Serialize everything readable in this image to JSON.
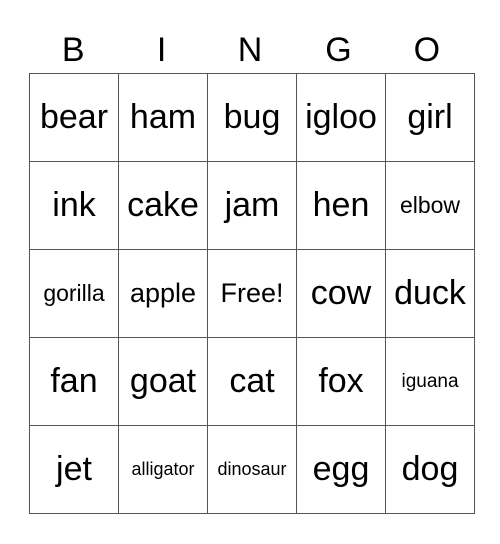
{
  "header": [
    "B",
    "I",
    "N",
    "G",
    "O"
  ],
  "rows": [
    [
      "bear",
      "ham",
      "bug",
      "igloo",
      "girl"
    ],
    [
      "ink",
      "cake",
      "jam",
      "hen",
      "elbow"
    ],
    [
      "gorilla",
      "apple",
      "Free!",
      "cow",
      "duck"
    ],
    [
      "fan",
      "goat",
      "cat",
      "fox",
      "iguana"
    ],
    [
      "jet",
      "alligator",
      "dinosaur",
      "egg",
      "dog"
    ]
  ]
}
